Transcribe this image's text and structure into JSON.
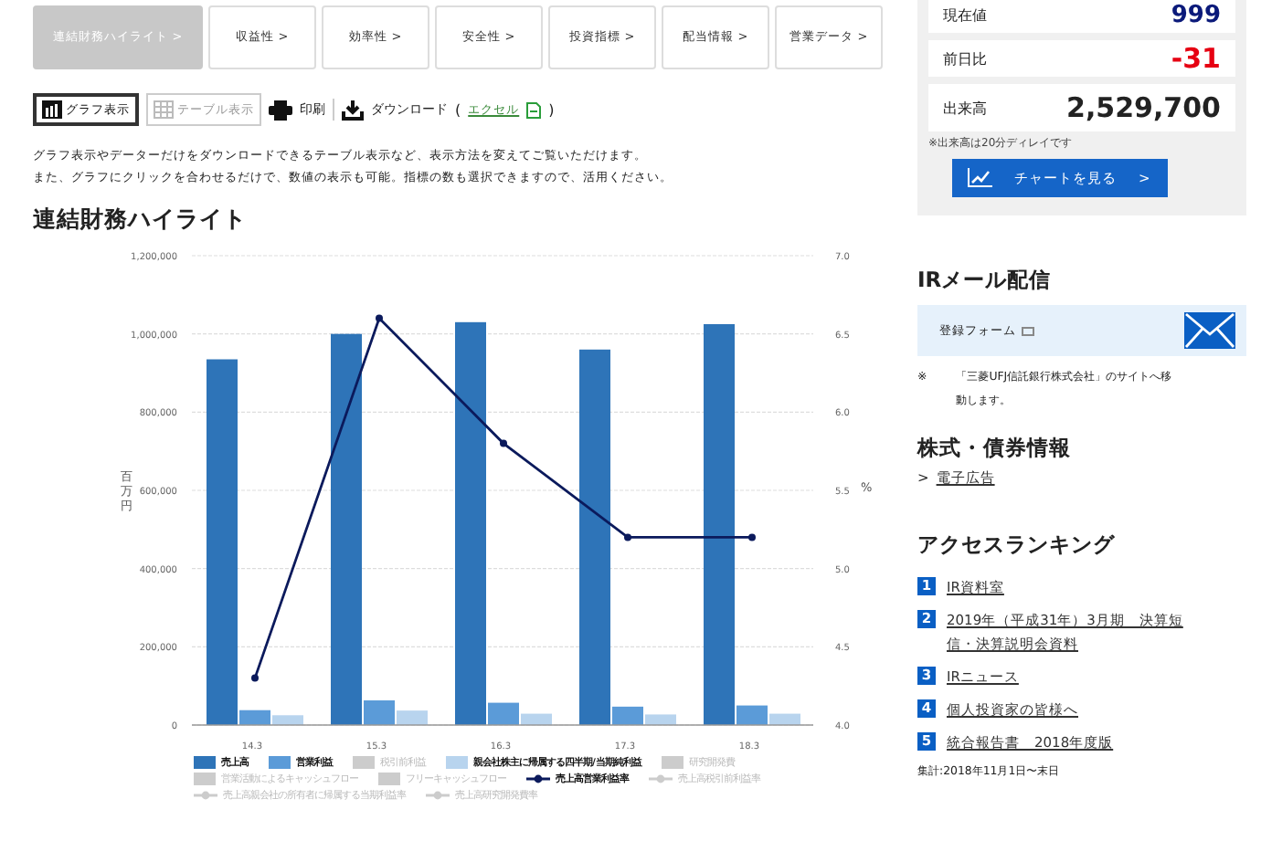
{
  "tabs": [
    {
      "label": "連結財務ハイライト >",
      "selected": true
    },
    {
      "label": "収益性 >",
      "selected": false
    },
    {
      "label": "効率性 >",
      "selected": false
    },
    {
      "label": "安全性 >",
      "selected": false
    },
    {
      "label": "投資指標 >",
      "selected": false
    },
    {
      "label": "配当情報 >",
      "selected": false
    },
    {
      "label": "営業データ >",
      "selected": false
    }
  ],
  "view_toolbar": {
    "views": [
      {
        "label": "グラフ表示",
        "kind": "graph",
        "selected": true
      },
      {
        "label": "テーブル表示",
        "kind": "table",
        "selected": false
      }
    ],
    "print": "印刷",
    "download": "ダウンロード",
    "excel_open": "(",
    "excel": "エクセル",
    "excel_close": ")"
  },
  "description": [
    "グラフ表示やデーターだけをダウンロードできるテーブル表示など、表示方法を変えてご覧いただけます。",
    "また、グラフにクリックを合わせるだけで、数値の表示も可能。指標の数も選択できますので、活用ください。"
  ],
  "section_title": "連結財務ハイライト",
  "chart": {
    "chart_data": {
      "type": "bar",
      "ylabel": "百万円",
      "y2label": "%",
      "categories": [
        "14.3",
        "15.3",
        "16.3",
        "17.3",
        "18.3"
      ],
      "stacked": false,
      "grid": true,
      "legend": "bottom",
      "series": [
        {
          "name": "売上高",
          "type": "bar",
          "color": "#2e74b8",
          "values": [
            935000,
            1000000,
            1030000,
            960000,
            1025000
          ]
        },
        {
          "name": "営業利益",
          "type": "bar",
          "color": "#5b9bd8",
          "values": [
            38000,
            63000,
            57000,
            47000,
            50000
          ]
        },
        {
          "name": "親会社株主に帰属する四半期/当期純利益",
          "type": "bar",
          "color": "#b8d4ee",
          "values": [
            25000,
            37000,
            29000,
            27000,
            29000
          ]
        },
        {
          "name": "売上高営業利益率",
          "type": "line",
          "color": "#0b1a5c",
          "axis": "y2",
          "marker": true,
          "values": [
            4.3,
            6.6,
            5.8,
            5.2,
            5.2
          ]
        }
      ],
      "ylim": [
        0,
        1200000
      ],
      "yticks": [
        {
          "value": 0,
          "label": "0"
        },
        {
          "value": 200000,
          "label": "200,000"
        },
        {
          "value": 400000,
          "label": "400,000"
        },
        {
          "value": 600000,
          "label": "600,000"
        },
        {
          "value": 800000,
          "label": "800,000"
        },
        {
          "value": 1000000,
          "label": "1,000,000"
        },
        {
          "value": 1200000,
          "label": "1,200,000"
        }
      ],
      "y2lim": [
        4,
        7
      ],
      "y2ticks": [
        {
          "value": 4,
          "label": "4.0"
        },
        {
          "value": 4.5,
          "label": "4.5"
        },
        {
          "value": 5,
          "label": "5.0"
        },
        {
          "value": 5.5,
          "label": "5.5"
        },
        {
          "value": 6,
          "label": "6.0"
        },
        {
          "value": 6.5,
          "label": "6.5"
        },
        {
          "value": 7,
          "label": "7.0"
        }
      ]
    },
    "legend": [
      {
        "kind": "bar",
        "active": true
      },
      {
        "kind": "bar",
        "active": true
      },
      {
        "label": "税引前利益",
        "kind": "bar",
        "active": false
      },
      {
        "kind": "bar",
        "active": true
      },
      {
        "label": "研究開発費",
        "kind": "bar",
        "active": false
      },
      {
        "label": "営業活動によるキャッシュフロー",
        "kind": "bar",
        "active": false
      },
      {
        "label": "フリーキャッシュフロー",
        "kind": "bar",
        "active": false
      },
      {
        "kind": "line",
        "active": true
      },
      {
        "label": "売上高税引前利益率",
        "kind": "line",
        "active": false
      },
      {
        "label": "売上高親会社の所有者に帰属する当期利益率",
        "kind": "line",
        "active": false
      },
      {
        "label": "売上高研究開発費率",
        "kind": "line",
        "active": false
      }
    ]
  },
  "stock": {
    "rows": [
      {
        "label": "現在値",
        "value": "999",
        "kind": "price"
      },
      {
        "label": "前日比",
        "value": "-31",
        "kind": "change"
      },
      {
        "label": "出来高",
        "value": "2,529,700",
        "kind": "volume"
      }
    ],
    "note": "※出来高は20分ディレイです",
    "chart_button": "チャートを見る",
    "chart_button_arrow": ">"
  },
  "ir_mail": {
    "title": "IRメール配信",
    "form_link": "登録フォーム",
    "note_mark": "※",
    "note": "「三菱UFJ信託銀行株式会社」のサイトへ移動します。"
  },
  "stock_bond": {
    "title": "株式・債券情報",
    "link_mark": ">",
    "link": "電子広告"
  },
  "ranking": {
    "title": "アクセスランキング",
    "items": [
      {
        "rank": "1",
        "label": "IR資料室"
      },
      {
        "rank": "2",
        "label": "2019年（平成31年）3月期　決算短信・決算説明会資料"
      },
      {
        "rank": "3",
        "label": "IRニュース"
      },
      {
        "rank": "4",
        "label": "個人投資家の皆様へ"
      },
      {
        "rank": "5",
        "label": "統合報告書　2018年度版"
      }
    ],
    "period": "集計:2018年11月1日〜末日"
  }
}
